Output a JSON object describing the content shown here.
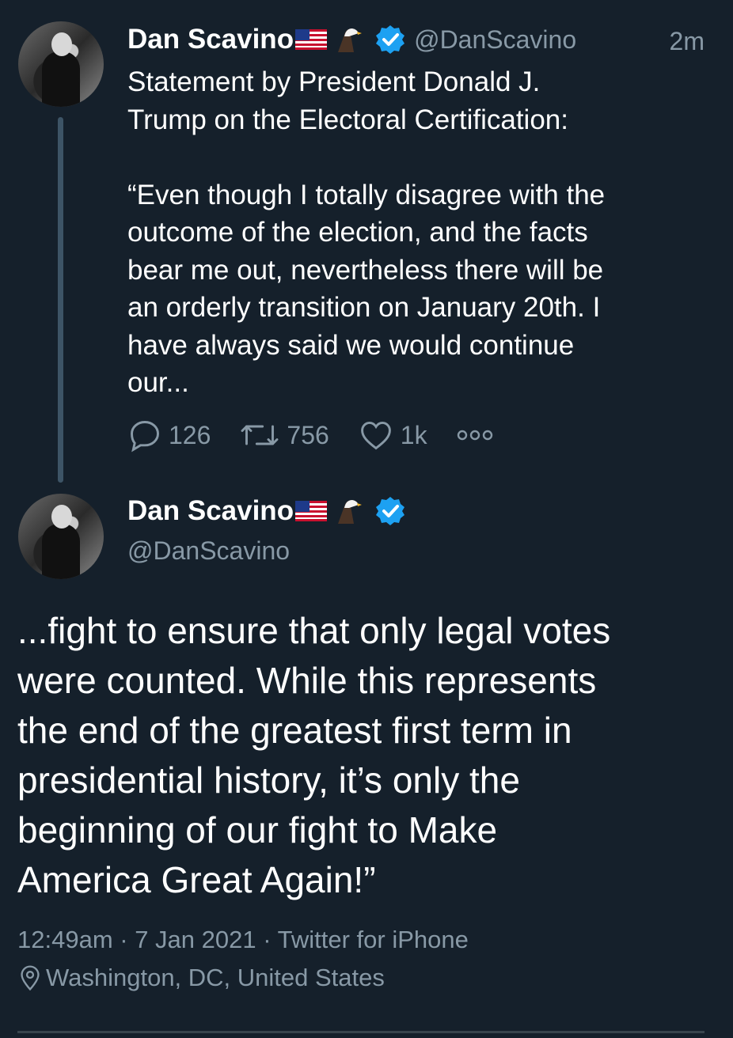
{
  "tweet1": {
    "name": "Dan Scavino",
    "handle": "@DanScavino",
    "time_ago": "2m",
    "text": "Statement by President Donald J.\nTrump on the Electoral Certification:\n\n“Even though I totally disagree with the\noutcome of the election, and the facts\nbear me out, nevertheless there will be\nan orderly transition on January 20th. I\nhave always said we would continue\nour...",
    "replies": "126",
    "retweets": "756",
    "likes": "1k"
  },
  "tweet2": {
    "name": "Dan Scavino",
    "handle": "@DanScavino",
    "text": "...fight to ensure that only legal votes\nwere counted. While this represents\nthe end of the greatest first term in\npresidential history, it’s only the\nbeginning of our fight to Make\nAmerica Great Again!”",
    "time": "12:49am",
    "date": "7 Jan 2021",
    "source": "Twitter for iPhone",
    "location": "Washington, DC, United States"
  },
  "colors": {
    "background": "#15202b",
    "secondary_text": "#8899a6",
    "verified_blue": "#1da1f2",
    "thread_line": "#3d5466"
  },
  "icons": [
    "us-flag-emoji",
    "eagle-emoji",
    "verified-badge-icon",
    "reply-icon",
    "retweet-icon",
    "like-icon",
    "more-icon",
    "location-pin-icon"
  ]
}
